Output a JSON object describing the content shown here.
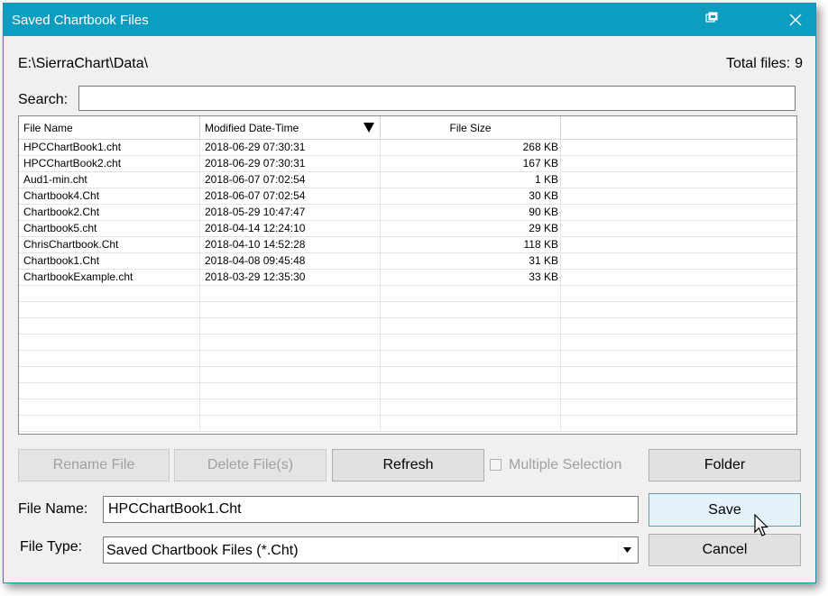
{
  "window": {
    "title": "Saved Chartbook Files"
  },
  "titlebar": {
    "restore_icon": "window-restore-icon",
    "close_icon": "close-icon"
  },
  "header": {
    "path": "E:\\SierraChart\\Data\\",
    "total_label": "Total files:",
    "total_count": "9"
  },
  "search": {
    "label": "Search:",
    "value": ""
  },
  "table": {
    "columns": [
      "File Name",
      "Modified Date-Time",
      "File Size"
    ],
    "sort_icon": "sort-descending-icon",
    "rows": [
      {
        "name": "HPCChartBook1.cht",
        "date": "2018-06-29   07:30:31",
        "size": "268 KB"
      },
      {
        "name": "HPCChartBook2.cht",
        "date": "2018-06-29   07:30:31",
        "size": "167 KB"
      },
      {
        "name": "Aud1-min.cht",
        "date": "2018-06-07   07:02:54",
        "size": "1 KB"
      },
      {
        "name": "Chartbook4.Cht",
        "date": "2018-06-07   07:02:54",
        "size": "30 KB"
      },
      {
        "name": "Chartbook2.Cht",
        "date": "2018-05-29   10:47:47",
        "size": "90 KB"
      },
      {
        "name": "Chartbook5.cht",
        "date": "2018-04-14   12:24:10",
        "size": "29 KB"
      },
      {
        "name": "ChrisChartbook.Cht",
        "date": "2018-04-10   14:52:28",
        "size": "118 KB"
      },
      {
        "name": "Chartbook1.Cht",
        "date": "2018-04-08   09:45:48",
        "size": "31 KB"
      },
      {
        "name": "ChartbookExample.cht",
        "date": "2018-03-29   12:35:30",
        "size": "33 KB"
      }
    ]
  },
  "buttons": {
    "rename": "Rename File",
    "delete": "Delete File(s)",
    "refresh": "Refresh",
    "multiple_selection": "Multiple Selection",
    "folder": "Folder",
    "save": "Save",
    "cancel": "Cancel"
  },
  "file_name": {
    "label": "File Name:",
    "value": "HPCChartBook1.Cht"
  },
  "file_type": {
    "label": "File Type:",
    "value": "Saved Chartbook Files (*.Cht)",
    "arrow_icon": "dropdown-arrow-icon"
  },
  "colors": {
    "titlebar": "#0c9dc1",
    "dialog_bg": "#f0f0f0",
    "disabled_text": "#a0a0a0"
  }
}
